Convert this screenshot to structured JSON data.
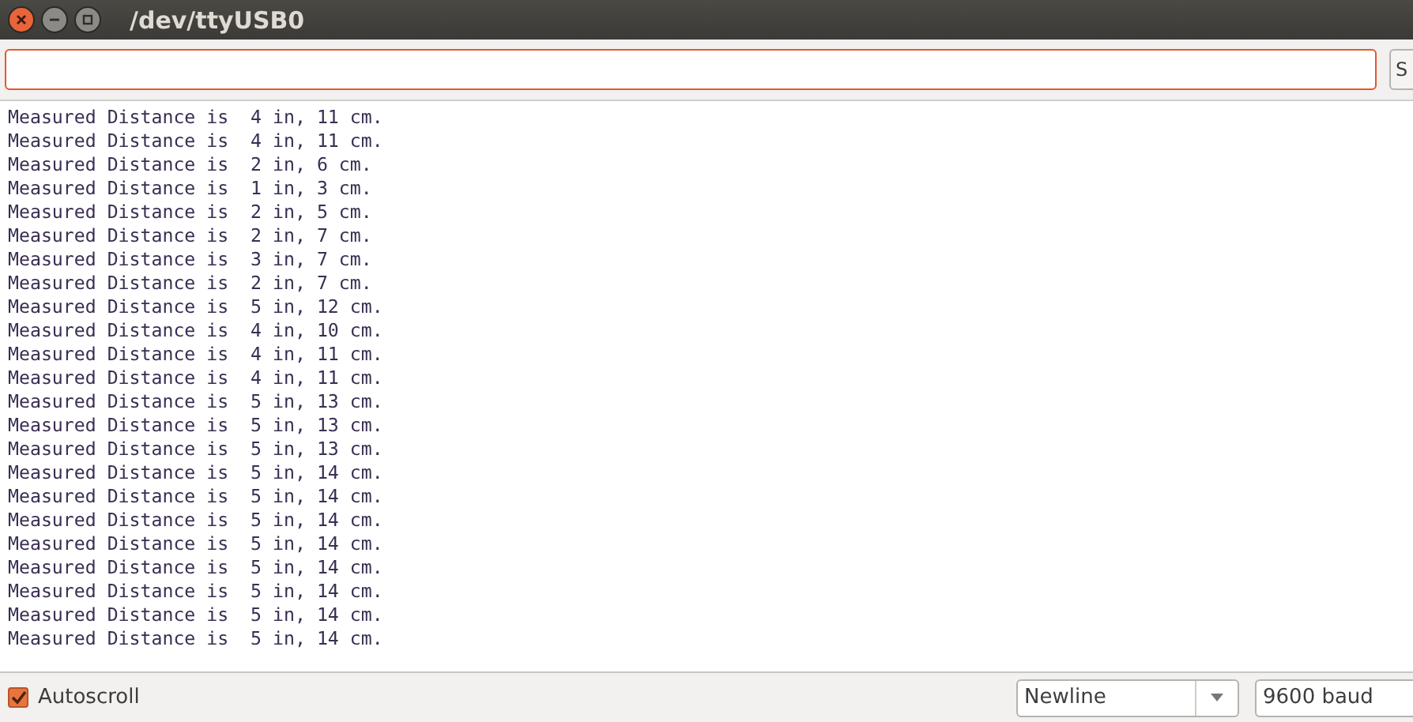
{
  "window": {
    "title": "/dev/ttyUSB0"
  },
  "input": {
    "focused": true
  },
  "send_button": {
    "label": "S"
  },
  "output_lines": [
    "Measured Distance is  4 in, 11 cm.",
    "Measured Distance is  4 in, 11 cm.",
    "Measured Distance is  2 in, 6 cm.",
    "Measured Distance is  1 in, 3 cm.",
    "Measured Distance is  2 in, 5 cm.",
    "Measured Distance is  2 in, 7 cm.",
    "Measured Distance is  3 in, 7 cm.",
    "Measured Distance is  2 in, 7 cm.",
    "Measured Distance is  5 in, 12 cm.",
    "Measured Distance is  4 in, 10 cm.",
    "Measured Distance is  4 in, 11 cm.",
    "Measured Distance is  4 in, 11 cm.",
    "Measured Distance is  5 in, 13 cm.",
    "Measured Distance is  5 in, 13 cm.",
    "Measured Distance is  5 in, 13 cm.",
    "Measured Distance is  5 in, 14 cm.",
    "Measured Distance is  5 in, 14 cm.",
    "Measured Distance is  5 in, 14 cm.",
    "Measured Distance is  5 in, 14 cm.",
    "Measured Distance is  5 in, 14 cm.",
    "Measured Distance is  5 in, 14 cm.",
    "Measured Distance is  5 in, 14 cm.",
    "Measured Distance is  5 in, 14 cm."
  ],
  "footer": {
    "autoscroll": {
      "label": "Autoscroll",
      "checked": true
    },
    "line_ending": "Newline",
    "baud": "9600 baud"
  }
}
